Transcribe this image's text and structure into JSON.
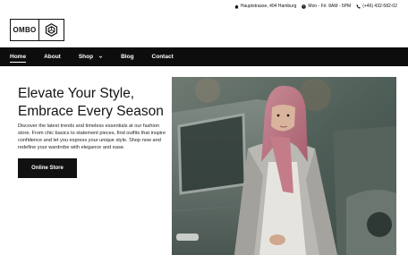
{
  "topbar": {
    "address": "Hauptstrasse, 404 Hamburg",
    "hours": "Mon - Fri: 8AM - 5PM",
    "phone": "(+46) 432-582-02"
  },
  "logo": {
    "text": "OMBO"
  },
  "nav": {
    "items": [
      {
        "label": "Home",
        "active": true
      },
      {
        "label": "About"
      },
      {
        "label": "Shop",
        "dropdown": true
      },
      {
        "label": "Blog"
      },
      {
        "label": "Contact"
      }
    ]
  },
  "hero": {
    "title_line1": "Elevate Your Style,",
    "title_line2": "Embrace Every Season",
    "description": "Discover the latest trends and timeless essentials at our fashion store. From chic basics to statement pieces, find outfits that inspire confidence and let you express your unique style. Shop now and redefine your wardrobe with elegance and ease.",
    "button_label": "Online Store"
  }
}
